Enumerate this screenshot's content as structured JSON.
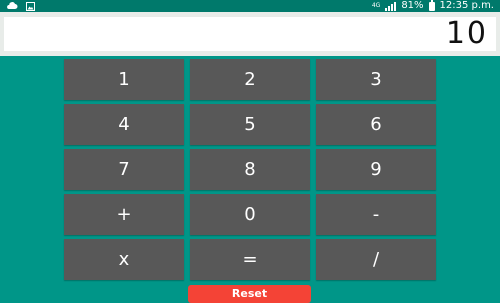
{
  "status_bar": {
    "network_type": "4G",
    "battery_percent": "81%",
    "time": "12:35 p.m.",
    "left_icons": [
      "cloud-icon",
      "gallery-icon"
    ]
  },
  "display": {
    "value": "10"
  },
  "keypad": {
    "keys": [
      "1",
      "2",
      "3",
      "4",
      "5",
      "6",
      "7",
      "8",
      "9",
      "+",
      "0",
      "-",
      "x",
      "=",
      "/"
    ]
  },
  "reset_label": "Reset",
  "colors": {
    "background": "#009688",
    "status_bar": "#00796b",
    "key": "#585858",
    "reset": "#f44336"
  }
}
